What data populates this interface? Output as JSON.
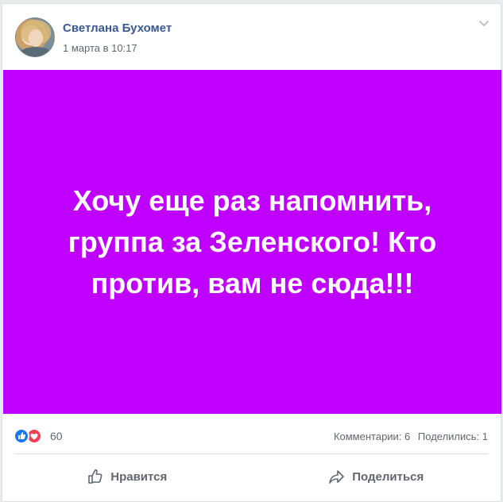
{
  "post": {
    "author": "Светлана Бухомет",
    "timestamp": "1 марта в 10:17",
    "text": "Хочу еще раз напомнить, группа за Зеленского! Кто против, вам не сюда!!!",
    "background_color": "#c000ff"
  },
  "reactions": {
    "count": "60",
    "types": [
      "like-icon",
      "love-icon"
    ]
  },
  "meta": {
    "comments": "Комментарии: 6",
    "shares": "Поделились: 1"
  },
  "actions": {
    "like_label": "Нравится",
    "share_label": "Поделиться"
  },
  "colors": {
    "author": "#385898",
    "like": "#1877f2",
    "love": "#f33e58"
  }
}
